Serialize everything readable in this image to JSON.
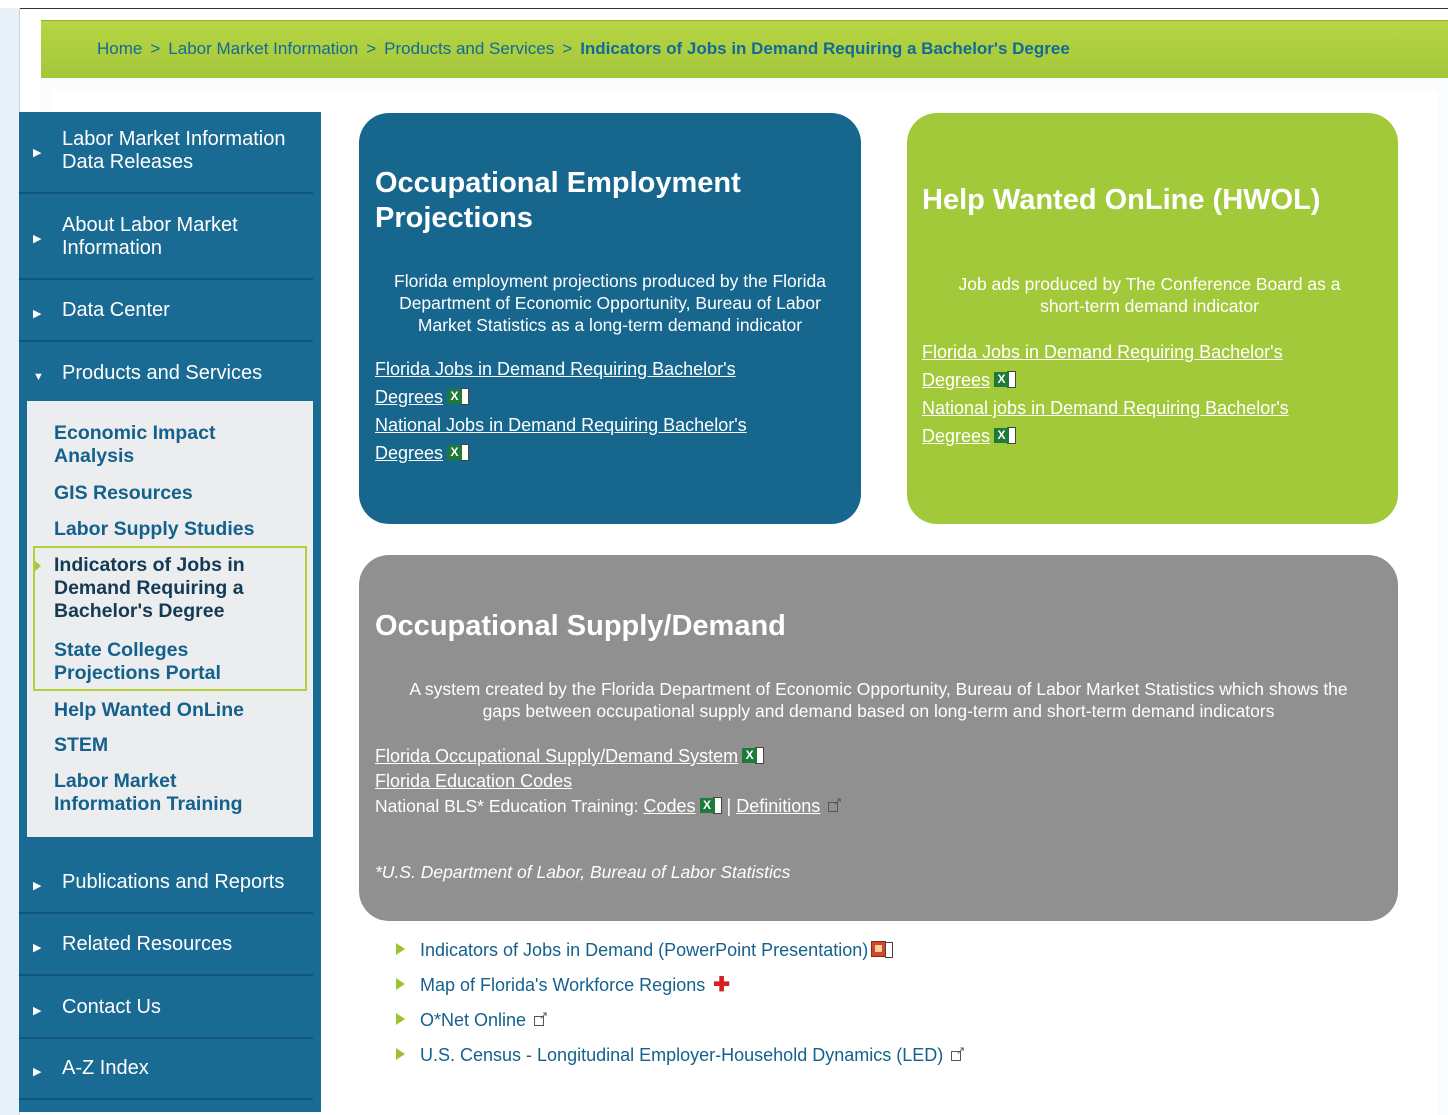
{
  "breadcrumb": {
    "items": [
      "Home",
      "Labor Market Information",
      "Products and Services"
    ],
    "current": "Indicators of Jobs in Demand Requiring a Bachelor's Degree",
    "separator": ">"
  },
  "sidebar": {
    "top_items": [
      {
        "label_line1": "Labor Market Information",
        "label_line2": "Data Releases"
      },
      {
        "label_line1": "About Labor Market",
        "label_line2": "Information"
      },
      {
        "label": "Data Center"
      },
      {
        "label": "Products and Services"
      }
    ],
    "submenu": [
      {
        "line1": "Economic Impact",
        "line2": "Analysis"
      },
      {
        "line1": "GIS Resources"
      },
      {
        "line1": "Labor Supply Studies"
      },
      {
        "line1": "Indicators of Jobs in",
        "line2": "Demand Requiring a",
        "line3": "Bachelor's Degree"
      },
      {
        "line1": "State Colleges",
        "line2": "Projections Portal"
      },
      {
        "line1": "Help Wanted OnLine"
      },
      {
        "line1": "STEM"
      },
      {
        "line1": "Labor Market",
        "line2": "Information Training"
      }
    ],
    "bottom_items": [
      {
        "label": "Publications and Reports"
      },
      {
        "label": "Related Resources"
      },
      {
        "label": "Contact Us"
      },
      {
        "label": "A-Z Index"
      }
    ]
  },
  "cards": {
    "projections": {
      "title_line1": "Occupational Employment",
      "title_line2": "Projections",
      "desc_line1": "Florida employment projections produced by the Florida",
      "desc_line2": "Department of Economic Opportunity, Bureau of Labor",
      "desc_line3": "Market Statistics as a long-term demand indicator",
      "link1_line1": "Florida Jobs in Demand Requiring Bachelor's",
      "link1_line2": "Degrees",
      "link2_line1": "National Jobs in Demand Requiring Bachelor's",
      "link2_line2": "Degrees"
    },
    "hwol": {
      "title": "Help Wanted OnLine (HWOL)",
      "desc_line1": "Job ads produced by The Conference Board as a",
      "desc_line2": "short-term demand indicator",
      "link1_line1": "Florida Jobs in Demand Requiring Bachelor's",
      "link1_line2": "Degrees",
      "link2_line1": "National jobs in Demand Requiring Bachelor's",
      "link2_line2": "Degrees"
    },
    "supply_demand": {
      "title": "Occupational Supply/Demand",
      "desc_line1": "A system created by the Florida Department of Economic Opportunity, Bureau of Labor Market Statistics which shows the",
      "desc_line2": "gaps between occupational supply and demand based on long-term and short-term demand indicators",
      "link1": "Florida Occupational Supply/Demand System",
      "link2": "Florida Education Codes",
      "bls_prefix": "National BLS* Education Training: ",
      "bls_codes": "Codes",
      "bls_sep": " | ",
      "bls_definitions": "Definitions",
      "footnote": "*U.S. Department of Labor, Bureau of Labor Statistics"
    }
  },
  "resources": [
    {
      "label": "Indicators of Jobs in Demand (PowerPoint Presentation)",
      "icon": "ppt-icon"
    },
    {
      "label": "Map of Florida's Workforce Regions",
      "icon": "pdf-icon"
    },
    {
      "label": "O*Net Online",
      "icon": "external-link-icon"
    },
    {
      "label": "U.S. Census - Longitudinal Employer-Household Dynamics (LED)",
      "icon": "external-link-icon"
    }
  ],
  "colors": {
    "nav_blue": "#1a6b93",
    "accent_green": "#a2c93a",
    "card_gray": "#909090",
    "link_blue": "#14618d"
  }
}
